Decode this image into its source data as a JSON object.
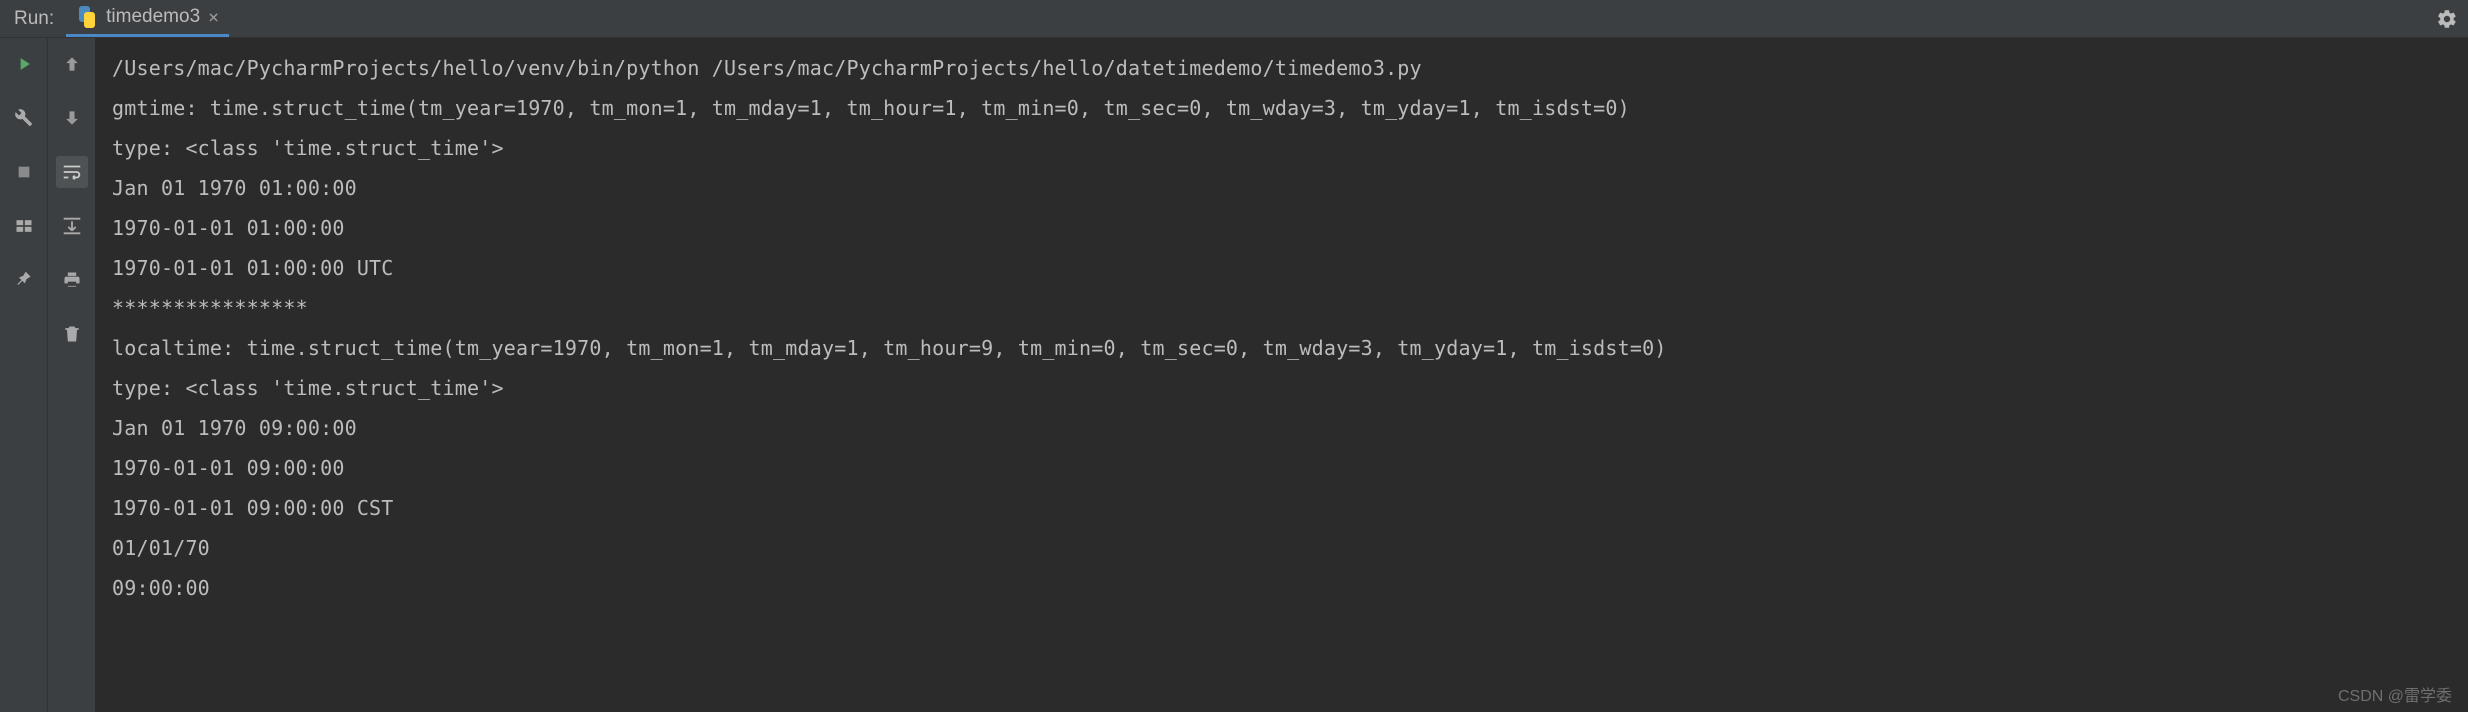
{
  "header": {
    "run_label": "Run:",
    "tab_name": "timedemo3"
  },
  "gutter_left": {
    "icons": [
      "run-icon",
      "wrench-icon",
      "stop-icon",
      "layout-icon",
      "pin-icon"
    ]
  },
  "gutter_mid": {
    "icons": [
      "arrow-up-icon",
      "arrow-down-icon",
      "soft-wrap-icon",
      "scroll-to-end-icon",
      "print-icon",
      "trash-icon"
    ]
  },
  "console": {
    "lines": [
      "/Users/mac/PycharmProjects/hello/venv/bin/python /Users/mac/PycharmProjects/hello/datetimedemo/timedemo3.py",
      "gmtime: time.struct_time(tm_year=1970, tm_mon=1, tm_mday=1, tm_hour=1, tm_min=0, tm_sec=0, tm_wday=3, tm_yday=1, tm_isdst=0)",
      "type: <class 'time.struct_time'>",
      "Jan 01 1970 01:00:00",
      "1970-01-01 01:00:00",
      "1970-01-01 01:00:00 UTC",
      "****************",
      "localtime: time.struct_time(tm_year=1970, tm_mon=1, tm_mday=1, tm_hour=9, tm_min=0, tm_sec=0, tm_wday=3, tm_yday=1, tm_isdst=0)",
      "type: <class 'time.struct_time'>",
      "Jan 01 1970 09:00:00",
      "1970-01-01 09:00:00",
      "1970-01-01 09:00:00 CST",
      "01/01/70",
      "09:00:00"
    ]
  },
  "watermark": "CSDN @雷学委"
}
